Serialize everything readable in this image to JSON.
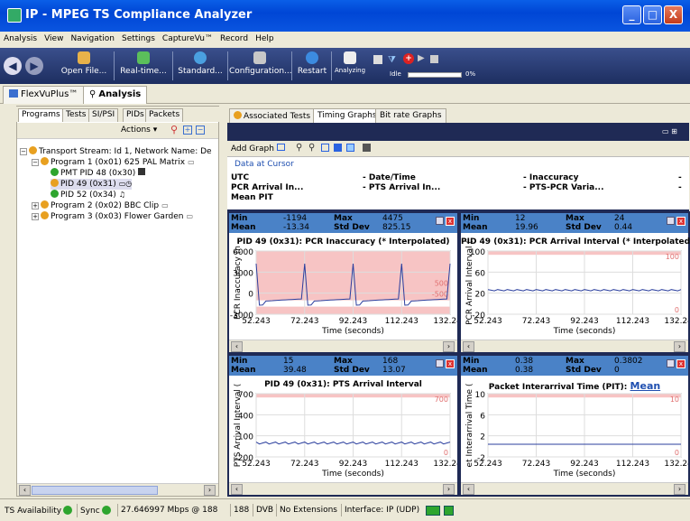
{
  "window": {
    "title": "IP - MPEG TS Compliance Analyzer",
    "min": "_",
    "max": "□",
    "close": "X"
  },
  "menu": [
    "Analysis",
    "View",
    "Navigation",
    "Settings",
    "CaptureVu™",
    "Record",
    "Help"
  ],
  "toolbar": {
    "open": "Open File...",
    "realtime": "Real-time...",
    "standard": "Standard...",
    "configuration": "Configuration...",
    "restart": "Restart",
    "analyzing": "Analyzing",
    "idle": "Idle",
    "progress_pct": "0%",
    "progress_value": 0
  },
  "main_tabs": {
    "flexvu": "FlexVuPlus™",
    "analysis": "Analysis"
  },
  "left_tabs": [
    "Programs",
    "Tests",
    "SI/PSI",
    "PIDs",
    "Packets"
  ],
  "actions_label": "Actions ▾",
  "tree": [
    "Transport Stream: Id 1, Network Name: De",
    "Program 1 (0x01) 625 PAL Matrix",
    "PMT PID 48 (0x30)",
    "PID 49 (0x31)",
    "PID 52 (0x34)",
    "Program 2 (0x02) BBC Clip",
    "Program 3 (0x03) Flower Garden"
  ],
  "right_tabs": [
    "Associated Tests",
    "Timing Graphs",
    "Bit rate Graphs"
  ],
  "add_graph": "Add Graph",
  "data_at_cursor": {
    "title": "Data at Cursor",
    "utc": "UTC",
    "pcr_arrival": "PCR Arrival In...",
    "mean_pit": "Mean PIT",
    "date_time": "- Date/Time",
    "pts_arrival": "- PTS Arrival In...",
    "inaccuracy": "- Inaccuracy",
    "pts_pcr": "- PTS-PCR Varia...",
    "dash": "-"
  },
  "stat_labels": {
    "min": "Min",
    "max": "Max",
    "mean": "Mean",
    "std": "Std Dev"
  },
  "x_ticks": [
    "52.243",
    "72.243",
    "92.243",
    "112.243",
    "132.243"
  ],
  "x_label": "Time (seconds)",
  "graphs": [
    {
      "min": "-1194",
      "max": "4475",
      "mean": "-13.34",
      "std": "825.15",
      "title": "PID 49 (0x31): PCR Inaccuracy (* Interpolated)",
      "ylabel": "PCR Inaccuracy (n",
      "yticks": [
        "6000",
        "3000",
        "0",
        "-3000"
      ],
      "limit_hi": "500",
      "limit_lo": "-500"
    },
    {
      "min": "12",
      "max": "24",
      "mean": "19.96",
      "std": "0.44",
      "title": "PID 49 (0x31): PCR Arrival Interval (* Interpolated)",
      "ylabel": "PCR Arrival Interval (",
      "yticks": [
        "100",
        "60",
        "20",
        "-20"
      ],
      "limit_hi": "100",
      "limit_lo": "0"
    },
    {
      "min": "15",
      "max": "168",
      "mean": "39.48",
      "std": "13.07",
      "title": "PID 49 (0x31): PTS Arrival Interval",
      "ylabel": "PTS Arrival Interval (",
      "yticks": [
        "700",
        "400",
        "100",
        "-200"
      ],
      "limit_hi": "700",
      "limit_lo": "0"
    },
    {
      "min": "0.38",
      "max": "0.3802",
      "mean": "0.38",
      "std": "0",
      "title": "Packet Interarrival Time (PIT): ",
      "title_mean": "Mean",
      "ylabel": "et Interarrival Time (",
      "yticks": [
        "10",
        "6",
        "2",
        "-2"
      ],
      "limit_hi": "10",
      "limit_lo": "0"
    }
  ],
  "status": {
    "ts_avail": "TS Availability",
    "sync": "Sync",
    "rate": "27.646997 Mbps @ 188",
    "pkt": "188",
    "std": "DVB",
    "ext": "No Extensions",
    "iface": "Interface: IP (UDP)"
  },
  "colors": {
    "accent": "#0046d5",
    "header": "#4a82c7",
    "limit_fill": "#f7c4c4",
    "line": "#2b3f9e"
  }
}
